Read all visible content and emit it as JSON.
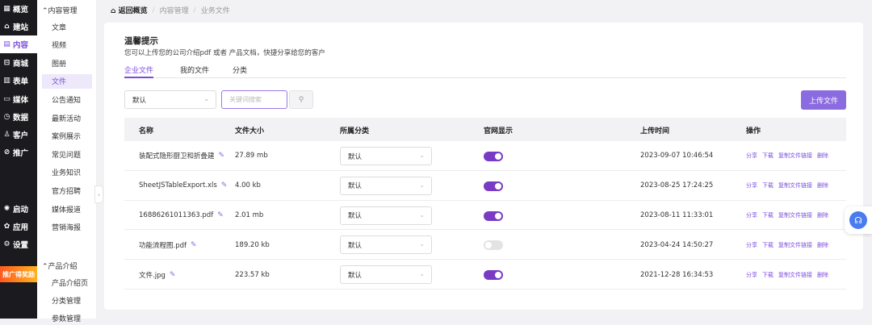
{
  "main_nav": [
    {
      "icon": "grid-icon",
      "glyph": "▦",
      "label": "概览",
      "active": false
    },
    {
      "icon": "home-icon",
      "glyph": "⌂",
      "label": "建站",
      "active": false
    },
    {
      "icon": "document-icon",
      "glyph": "▤",
      "label": "内容",
      "active": true
    },
    {
      "icon": "shop-icon",
      "glyph": "⊟",
      "label": "商城",
      "active": false
    },
    {
      "icon": "form-icon",
      "glyph": "▥",
      "label": "表单",
      "active": false
    },
    {
      "icon": "media-icon",
      "glyph": "▭",
      "label": "媒体",
      "active": false
    },
    {
      "icon": "data-icon",
      "glyph": "◷",
      "label": "数据",
      "active": false
    },
    {
      "icon": "customer-icon",
      "glyph": "♙",
      "label": "客户",
      "active": false
    },
    {
      "icon": "promote-icon",
      "glyph": "⊘",
      "label": "推广",
      "active": false
    },
    {
      "icon": "launch-icon",
      "glyph": "✺",
      "label": "启动",
      "active": false
    },
    {
      "icon": "apps-icon",
      "glyph": "✿",
      "label": "应用",
      "active": false
    },
    {
      "icon": "settings-icon",
      "glyph": "⚙",
      "label": "设置",
      "active": false
    }
  ],
  "promo_badge": "推广得奖励",
  "sub_nav": {
    "group1": "内容管理",
    "items1": [
      "文章",
      "视频",
      "图册",
      "文件",
      "公告通知",
      "最新活动",
      "案例展示",
      "常见问题",
      "业务知识",
      "官方招聘",
      "媒体报道",
      "营销海报"
    ],
    "active_item": "文件",
    "group2": "产品介绍",
    "items2": [
      "产品介绍页",
      "分类管理",
      "参数管理"
    ]
  },
  "breadcrumb": {
    "home": "返回概览",
    "level1": "内容管理",
    "level2": "业务文件",
    "sep": "/"
  },
  "tip": {
    "title": "温馨提示",
    "text": "您可以上传您的公司介绍pdf 或者 产品文档，快捷分享给您的客户"
  },
  "tabs": [
    "企业文件",
    "我的文件",
    "分类"
  ],
  "active_tab": "企业文件",
  "filter": {
    "select_value": "默认",
    "search_placeholder": "关键词搜索"
  },
  "upload_label": "上传文件",
  "table": {
    "headers": [
      "名称",
      "文件大小",
      "所属分类",
      "官网显示",
      "上传时间",
      "操作"
    ],
    "rows": [
      {
        "name": "装配式隐形厨卫和折叠建",
        "size": "27.89 mb",
        "category": "默认",
        "visible": true,
        "time": "2023-09-07 10:46:54"
      },
      {
        "name": "SheetJSTableExport.xls",
        "size": "4.00 kb",
        "category": "默认",
        "visible": true,
        "time": "2023-08-25 17:24:25"
      },
      {
        "name": "16886261011363.pdf",
        "size": "2.01 mb",
        "category": "默认",
        "visible": true,
        "time": "2023-08-11 11:33:01"
      },
      {
        "name": "功能流程图.pdf",
        "size": "189.20 kb",
        "category": "默认",
        "visible": false,
        "time": "2023-04-24 14:50:27"
      },
      {
        "name": "文件.jpg",
        "size": "223.57 kb",
        "category": "默认",
        "visible": true,
        "time": "2021-12-28 16:34:53"
      }
    ],
    "actions": [
      "分享",
      "下载",
      "复制文件链接",
      "删除"
    ]
  },
  "colors": {
    "accent": "#7b4cdc",
    "toggle_on": "#7a3bc4",
    "sidebar_bg": "#1b1b1f"
  }
}
